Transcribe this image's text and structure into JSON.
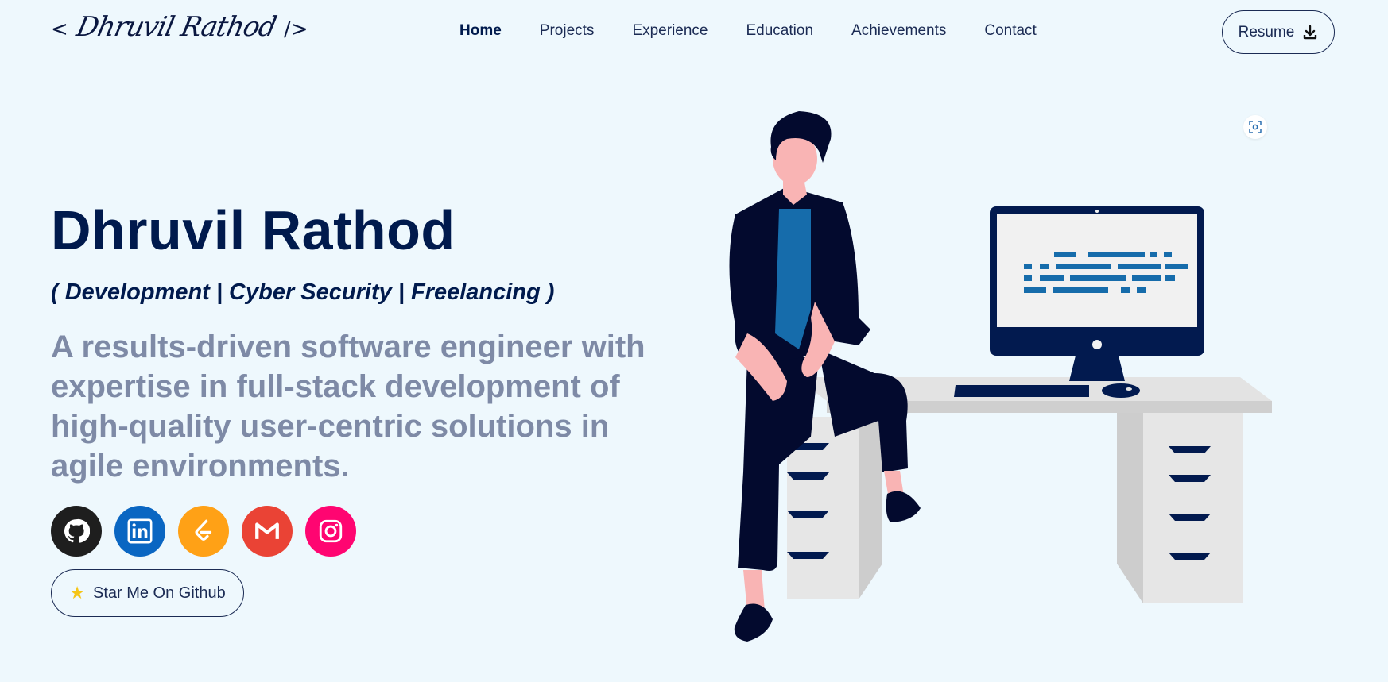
{
  "nav": {
    "logo_open": "<",
    "logo_signature": "Dhruvil Rathod",
    "logo_close": "/>",
    "items": [
      {
        "label": "Home",
        "active": true
      },
      {
        "label": "Projects"
      },
      {
        "label": "Experience"
      },
      {
        "label": "Education"
      },
      {
        "label": "Achievements"
      },
      {
        "label": "Contact"
      }
    ],
    "resume_label": "Resume"
  },
  "hero": {
    "name": "Dhruvil Rathod",
    "tagline": "( Development | Cyber Security | Freelancing )",
    "bio": "A results-driven software engineer with expertise in full-stack development of high-quality user-centric solutions in agile environments.",
    "star_label": "Star Me On Github"
  },
  "socials": [
    {
      "icon": "github-icon",
      "color": "#1e1e1e"
    },
    {
      "icon": "linkedin-icon",
      "color": "#0a66c2"
    },
    {
      "icon": "leetcode-icon",
      "color": "#ffa116"
    },
    {
      "icon": "gmail-icon",
      "color": "#ea4335"
    },
    {
      "icon": "instagram-icon",
      "color": "#ff0571"
    }
  ],
  "colors": {
    "background": "#eef8fd",
    "primary": "#001a4d",
    "muted": "#7e8aa6",
    "illustration_accent": "#166cab"
  }
}
